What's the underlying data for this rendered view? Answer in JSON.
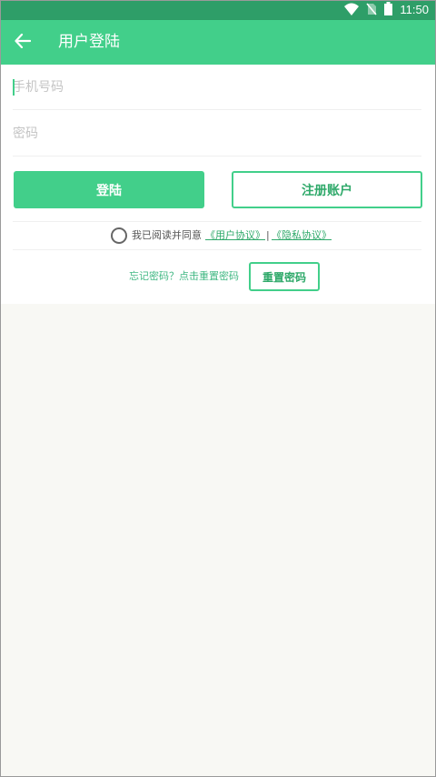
{
  "status_bar": {
    "time": "11:50",
    "icons": [
      "wifi-icon",
      "no-sim-icon",
      "battery-icon"
    ]
  },
  "app_bar": {
    "back_icon": "arrow-left-icon",
    "title": "用户登陆"
  },
  "form": {
    "phone_placeholder": "手机号码",
    "password_placeholder": "密码",
    "login_label": "登陆",
    "register_label": "注册账户"
  },
  "agreement": {
    "text": "我已阅读并同意",
    "user_agreement": "《用户协议》",
    "separator": "|",
    "privacy_policy": "《隐私协议》"
  },
  "reset": {
    "hint": "忘记密码？点击重置密码",
    "button_label": "重置密码"
  },
  "colors": {
    "status_bar": "#2e9e68",
    "primary": "#42cf8a",
    "accent_text": "#2fa96a",
    "background": "#f8f8f4"
  }
}
